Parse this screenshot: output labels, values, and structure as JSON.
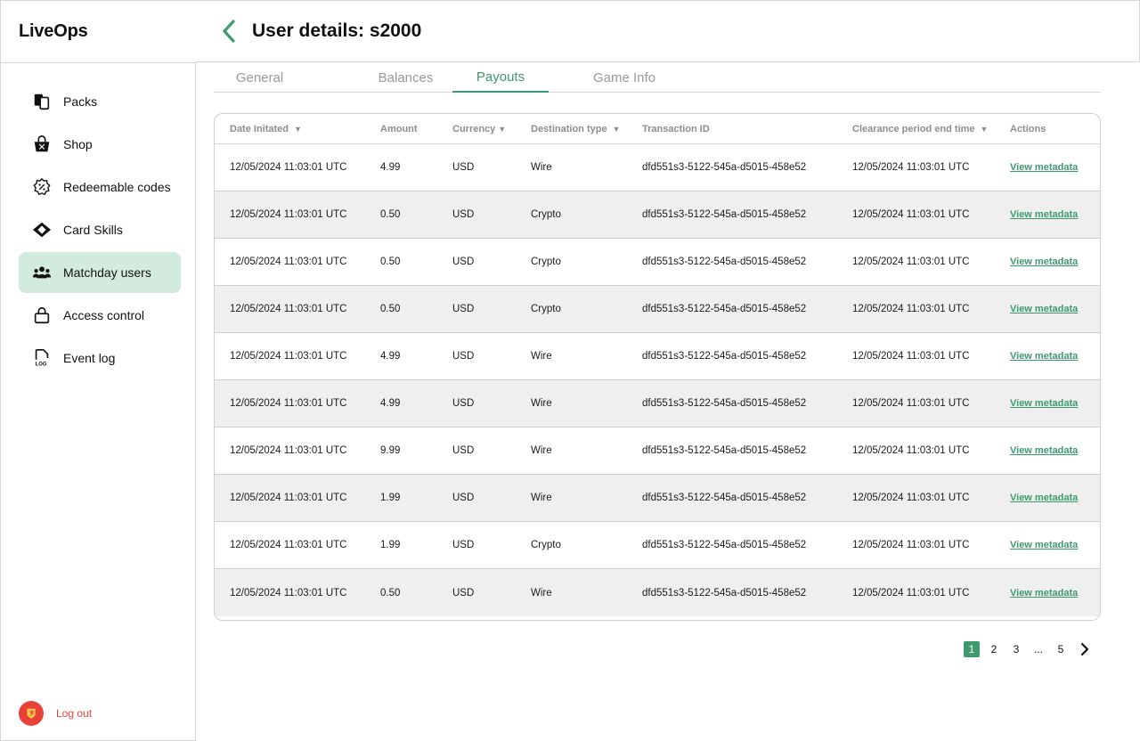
{
  "app": {
    "name": "LiveOps"
  },
  "sidebar": {
    "items": [
      {
        "label": "Packs",
        "icon": "packs-icon"
      },
      {
        "label": "Shop",
        "icon": "shop-basket-icon"
      },
      {
        "label": "Redeemable codes",
        "icon": "discount-badge-icon"
      },
      {
        "label": "Card Skills",
        "icon": "card-skills-icon"
      },
      {
        "label": "Matchday users",
        "icon": "users-group-icon",
        "active": true
      },
      {
        "label": "Access control",
        "icon": "lock-icon"
      },
      {
        "label": "Event log",
        "icon": "log-file-icon"
      }
    ],
    "logout_label": "Log out"
  },
  "header": {
    "title": "User details: s2000"
  },
  "tabs": [
    {
      "label": "General"
    },
    {
      "label": "Balances"
    },
    {
      "label": "Payouts",
      "active": true
    },
    {
      "label": "Game Info"
    }
  ],
  "table": {
    "columns": [
      {
        "label": "Date Initated",
        "sortable": true
      },
      {
        "label": "Amount",
        "sortable": false
      },
      {
        "label": "Currency",
        "sortable": true
      },
      {
        "label": "Destination type",
        "sortable": true
      },
      {
        "label": "Transaction ID",
        "sortable": false
      },
      {
        "label": "Clearance period end time",
        "sortable": true
      },
      {
        "label": "Actions",
        "sortable": false
      }
    ],
    "rows": [
      {
        "date": "12/05/2024 11:03:01 UTC",
        "amount": "4.99",
        "currency": "USD",
        "dest": "Wire",
        "txid": "dfd551s3-5122-545a-d5015-458e52",
        "clearance": "12/05/2024 11:03:01 UTC",
        "action": "View metadata"
      },
      {
        "date": "12/05/2024 11:03:01 UTC",
        "amount": "0.50",
        "currency": "USD",
        "dest": "Crypto",
        "txid": "dfd551s3-5122-545a-d5015-458e52",
        "clearance": "12/05/2024 11:03:01 UTC",
        "action": "View metadata"
      },
      {
        "date": "12/05/2024 11:03:01 UTC",
        "amount": "0.50",
        "currency": "USD",
        "dest": "Crypto",
        "txid": "dfd551s3-5122-545a-d5015-458e52",
        "clearance": "12/05/2024 11:03:01 UTC",
        "action": "View metadata"
      },
      {
        "date": "12/05/2024 11:03:01 UTC",
        "amount": "0.50",
        "currency": "USD",
        "dest": "Crypto",
        "txid": "dfd551s3-5122-545a-d5015-458e52",
        "clearance": "12/05/2024 11:03:01 UTC",
        "action": "View metadata"
      },
      {
        "date": "12/05/2024 11:03:01 UTC",
        "amount": "4.99",
        "currency": "USD",
        "dest": "Wire",
        "txid": "dfd551s3-5122-545a-d5015-458e52",
        "clearance": "12/05/2024 11:03:01 UTC",
        "action": "View metadata"
      },
      {
        "date": "12/05/2024 11:03:01 UTC",
        "amount": "4.99",
        "currency": "USD",
        "dest": "Wire",
        "txid": "dfd551s3-5122-545a-d5015-458e52",
        "clearance": "12/05/2024 11:03:01 UTC",
        "action": "View metadata"
      },
      {
        "date": "12/05/2024 11:03:01 UTC",
        "amount": "9.99",
        "currency": "USD",
        "dest": "Wire",
        "txid": "dfd551s3-5122-545a-d5015-458e52",
        "clearance": "12/05/2024 11:03:01 UTC",
        "action": "View metadata"
      },
      {
        "date": "12/05/2024 11:03:01 UTC",
        "amount": "1.99",
        "currency": "USD",
        "dest": "Wire",
        "txid": "dfd551s3-5122-545a-d5015-458e52",
        "clearance": "12/05/2024 11:03:01 UTC",
        "action": "View metadata"
      },
      {
        "date": "12/05/2024 11:03:01 UTC",
        "amount": "1.99",
        "currency": "USD",
        "dest": "Crypto",
        "txid": "dfd551s3-5122-545a-d5015-458e52",
        "clearance": "12/05/2024 11:03:01 UTC",
        "action": "View metadata"
      },
      {
        "date": "12/05/2024 11:03:01 UTC",
        "amount": "0.50",
        "currency": "USD",
        "dest": "Wire",
        "txid": "dfd551s3-5122-545a-d5015-458e52",
        "clearance": "12/05/2024 11:03:01 UTC",
        "action": "View metadata"
      }
    ]
  },
  "pagination": {
    "pages": [
      "1",
      "2",
      "3",
      "...",
      "5"
    ],
    "current": "1"
  },
  "colors": {
    "accent": "#3d9a6e",
    "active_nav_bg": "#d3ebdf",
    "logout": "#e8413a",
    "row_alt": "#efefef"
  }
}
